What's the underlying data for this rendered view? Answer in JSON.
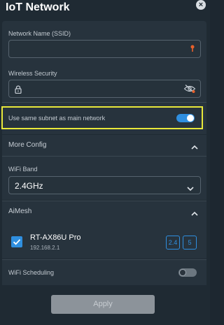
{
  "header": {
    "title": "IoT Network",
    "close_label": "×"
  },
  "network_name": {
    "label": "Network Name (SSID)",
    "value": "",
    "placeholder": ""
  },
  "wireless_security": {
    "label": "Wireless Security",
    "value": ""
  },
  "same_subnet": {
    "label": "Use same subnet as main network",
    "enabled": true
  },
  "more_config": {
    "label": "More Config"
  },
  "wifi_band": {
    "label": "WiFi Band",
    "selected": "2.4GHz"
  },
  "aimesh": {
    "label": "AiMesh",
    "device": {
      "name": "RT-AX86U Pro",
      "ip": "192.168.2.1",
      "checked": true,
      "bands": [
        "2.4",
        "5"
      ]
    }
  },
  "wifi_scheduling": {
    "label": "WiFi Scheduling",
    "enabled": false
  },
  "apply_label": "Apply",
  "colors": {
    "accent": "#2f8fe0",
    "highlight": "#e8e83a",
    "warning_icon": "#e8612b"
  }
}
